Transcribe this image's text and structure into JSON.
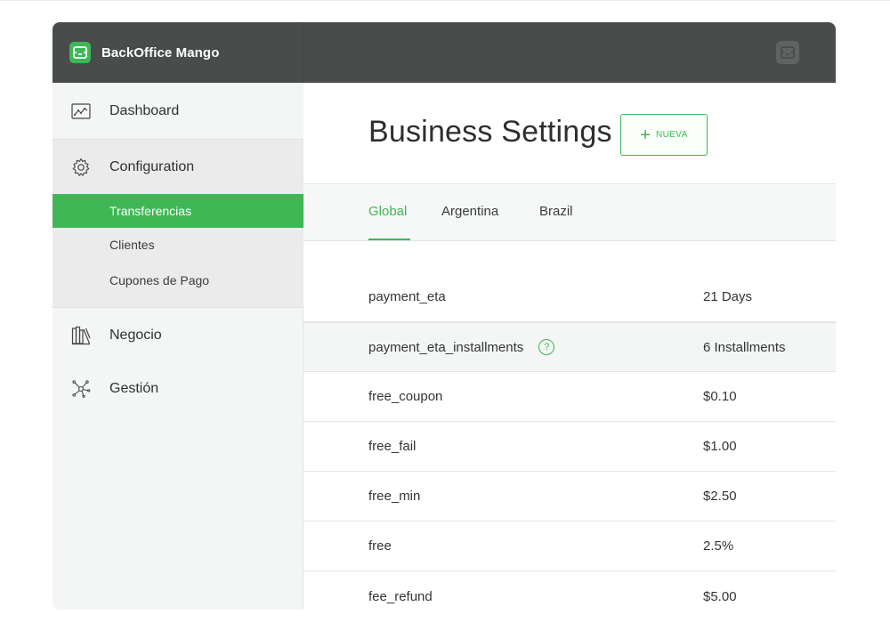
{
  "app": {
    "brand_name": "BackOffice Mango",
    "accent_color": "#3fb755",
    "header_color": "#484c4b"
  },
  "sidebar": {
    "items": [
      {
        "label": "Dashboard",
        "icon": "chart-line-icon"
      },
      {
        "label": "Configuration",
        "icon": "gear-icon"
      },
      {
        "label": "Negocio",
        "icon": "books-icon"
      },
      {
        "label": "Gestión",
        "icon": "network-icon"
      }
    ],
    "sub_items": [
      {
        "label": "Transferencias",
        "active": true
      },
      {
        "label": "Clientes",
        "active": false
      },
      {
        "label": "Cupones de Pago",
        "active": false
      }
    ]
  },
  "main": {
    "title": "Business Settings",
    "new_button": {
      "plus": "+",
      "label": "NUEVA"
    },
    "tabs": [
      {
        "label": "Global",
        "active": true
      },
      {
        "label": "Argentina",
        "active": false
      },
      {
        "label": "Brazil",
        "active": false
      }
    ],
    "settings": [
      {
        "key": "payment_eta",
        "value": "21 Days"
      },
      {
        "key": "payment_eta_installments",
        "value": "6 Installments",
        "help": "?"
      },
      {
        "key": "free_coupon",
        "value": "$0.10"
      },
      {
        "key": "free_fail",
        "value": "$1.00"
      },
      {
        "key": "free_min",
        "value": "$2.50"
      },
      {
        "key": "free",
        "value": "2.5%"
      },
      {
        "key": "fee_refund",
        "value": "$5.00"
      }
    ]
  }
}
